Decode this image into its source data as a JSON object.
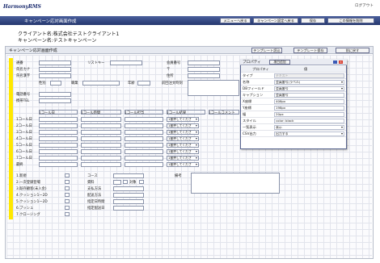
{
  "app": {
    "logo": "HarmonyRMS",
    "logout": "ログアウト",
    "window_title": "キャンペーン応対画面作成"
  },
  "nav_buttons": [
    "メニューへ戻る",
    "キャンペーン設定へ戻る",
    "保存",
    "この情報を削除"
  ],
  "info": {
    "client": "クライアント名:株式会社テストクライアント1",
    "campaign": "キャンペーン名:テストキャンペーン"
  },
  "panel": {
    "title": "キャンペーン応対画面作成",
    "buttons": [
      "テンプレート読込",
      "テンプレート保存",
      "前に戻す"
    ]
  },
  "form": {
    "row1": [
      "通番",
      "リストキー",
      "会員番号"
    ],
    "row2": [
      "氏名カナ",
      "〒"
    ],
    "row3": [
      "氏名漢字",
      "住所"
    ],
    "row4": [
      "性別",
      "職業",
      "年齢",
      "前回注文時刻"
    ],
    "row5": [
      "電話番号"
    ],
    "row6": [
      "携帯TEL"
    ],
    "call_headers": [
      "1コール日",
      "1コール時間",
      "1コール担当",
      "1コール結果",
      "1コールコメント"
    ],
    "call_rows": [
      "1コール日",
      "2コール日",
      "3コール日",
      "4コール日",
      "5コール日",
      "6コール日",
      "7コール日",
      "最終"
    ],
    "result_default": "1番押してくださ",
    "checklist": [
      "1.新規",
      "2.一次登録登場",
      "3.既存顧客(未入金)",
      "4.クッション1ー2D",
      "5.クッション1ー2D",
      "6.プッシュ",
      "7.クロージング"
    ],
    "course": [
      "コース",
      "資料",
      "支払方法",
      "配送方法",
      "指定日時間",
      "指定配送日"
    ],
    "course_small": "対象",
    "note_label": "備考"
  },
  "property": {
    "title": "プロパティ",
    "apply_button": "項目追加",
    "header": [
      "プロパティ",
      "値"
    ],
    "rows": [
      {
        "key": "タイプ",
        "value": "テキスト",
        "kind": "gray"
      },
      {
        "key": "名称",
        "value": "会員番号(ラベル)",
        "kind": "dd"
      },
      {
        "key": "DBフィールド",
        "value": "会員番号",
        "kind": "dd"
      },
      {
        "key": "キャプション",
        "value": "会員番号",
        "kind": "text"
      },
      {
        "key": "X座標",
        "value": "408px",
        "kind": "text"
      },
      {
        "key": "Y座標",
        "value": "198px",
        "kind": "text"
      },
      {
        "key": "幅",
        "value": "20px",
        "kind": "text"
      },
      {
        "key": "スタイル",
        "value": "color: black",
        "kind": "text"
      },
      {
        "key": "一覧表示",
        "value": "表示",
        "kind": "dd"
      },
      {
        "key": "CSV出力",
        "value": "出力する",
        "kind": "dd"
      }
    ]
  },
  "colors": {
    "titlebar": "#2b3f78",
    "highlight": "#ffe800",
    "grid": "#e2e4ec"
  }
}
